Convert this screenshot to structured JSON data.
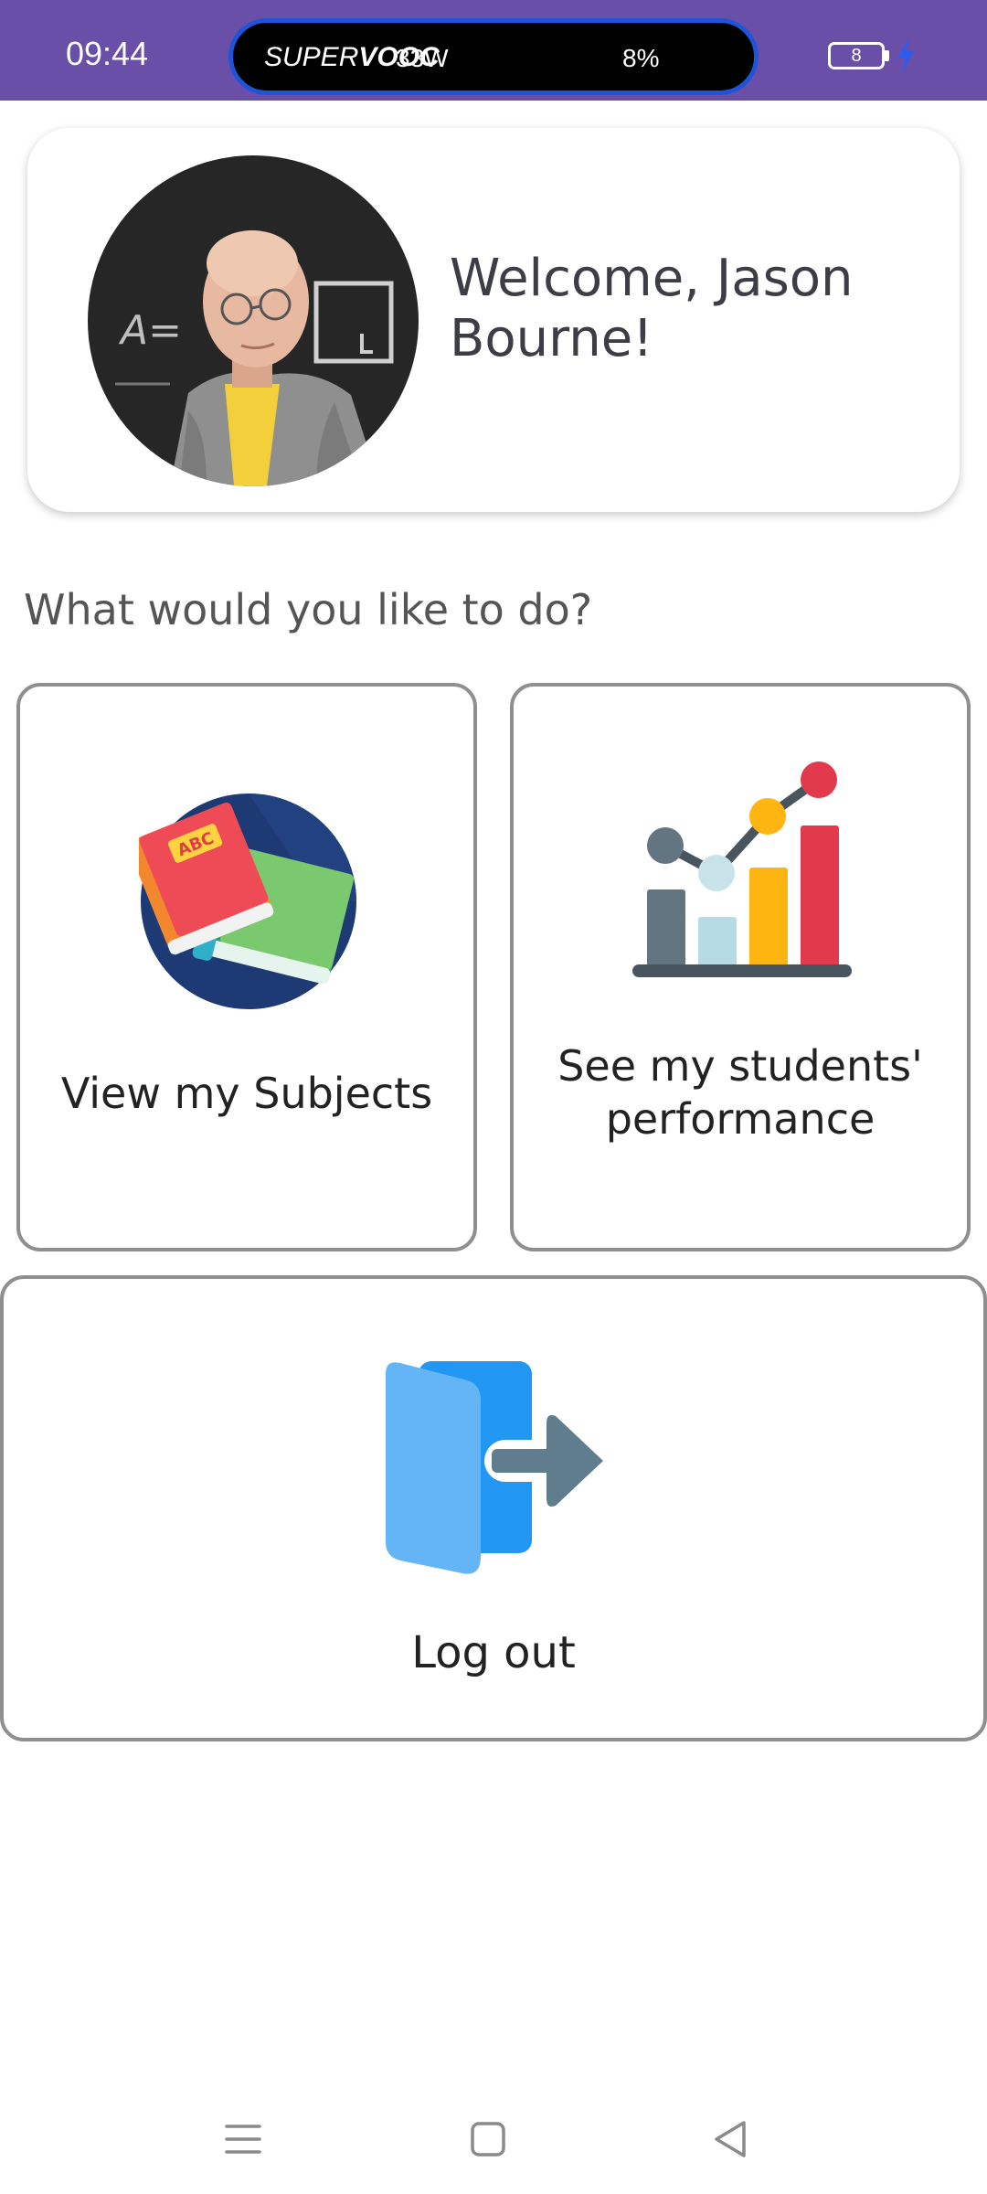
{
  "status_bar": {
    "time": "09:44",
    "charging_brand_light": "SUPER",
    "charging_brand_bold": "VOOC",
    "charging_power": "33W",
    "charging_percent": "8%",
    "battery_level": "8",
    "background_color": "#6a4fa8",
    "icons": [
      "battery-icon",
      "charging-bolt-icon"
    ]
  },
  "welcome": {
    "message": "Welcome, Jason Bourne!",
    "avatar": "teacher-profile-photo"
  },
  "prompt": "What would you like to do?",
  "actions": [
    {
      "label": "View my Subjects",
      "icon": "books-icon"
    },
    {
      "label": "See my students' performance",
      "icon": "performance-chart-icon"
    },
    {
      "label": "Log out",
      "icon": "logout-door-icon"
    }
  ],
  "nav_bar": {
    "buttons": [
      "menu-icon",
      "home-icon",
      "back-icon"
    ]
  }
}
